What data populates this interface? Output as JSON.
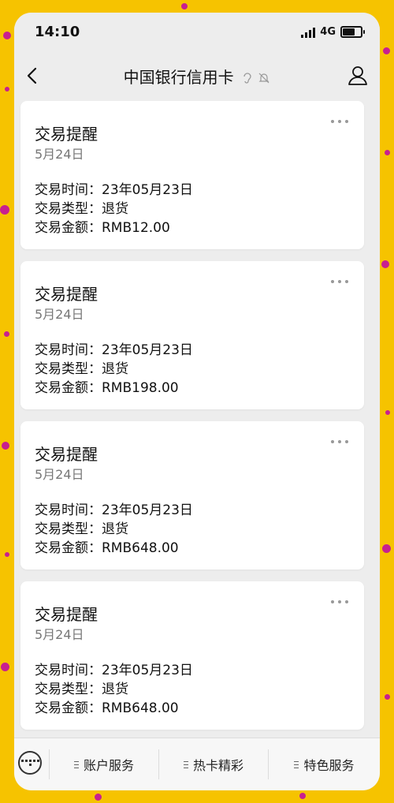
{
  "status_bar": {
    "time": "14:10",
    "network": "4G"
  },
  "nav": {
    "title": "中国银行信用卡"
  },
  "cards": [
    {
      "title": "交易提醒",
      "date": "5月24日",
      "rows": [
        {
          "label": "交易时间：",
          "value": "23年05月23日"
        },
        {
          "label": "交易类型：",
          "value": "退货"
        },
        {
          "label": "交易金额：",
          "value": "RMB12.00"
        }
      ]
    },
    {
      "title": "交易提醒",
      "date": "5月24日",
      "rows": [
        {
          "label": "交易时间：",
          "value": "23年05月23日"
        },
        {
          "label": "交易类型：",
          "value": "退货"
        },
        {
          "label": "交易金额：",
          "value": "RMB198.00"
        }
      ]
    },
    {
      "title": "交易提醒",
      "date": "5月24日",
      "rows": [
        {
          "label": "交易时间：",
          "value": "23年05月23日"
        },
        {
          "label": "交易类型：",
          "value": "退货"
        },
        {
          "label": "交易金额：",
          "value": "RMB648.00"
        }
      ]
    },
    {
      "title": "交易提醒",
      "date": "5月24日",
      "rows": [
        {
          "label": "交易时间：",
          "value": "23年05月23日"
        },
        {
          "label": "交易类型：",
          "value": "退货"
        },
        {
          "label": "交易金额：",
          "value": "RMB648.00"
        }
      ]
    }
  ],
  "bottom_menu": {
    "items": [
      {
        "label": "账户服务"
      },
      {
        "label": "热卡精彩"
      },
      {
        "label": "特色服务"
      }
    ]
  }
}
